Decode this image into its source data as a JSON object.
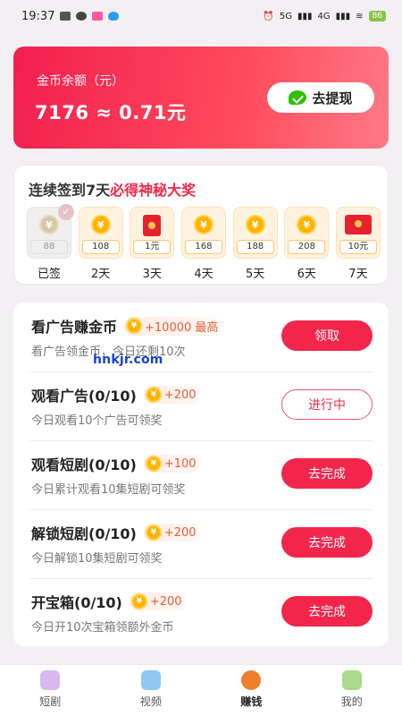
{
  "status_bar": {
    "time": "19:37",
    "network": "5G",
    "network2": "4G",
    "battery": "86"
  },
  "balance": {
    "label": "金币余额（元）",
    "value": "7176 ≈ 0.71元",
    "withdraw_label": "去提现"
  },
  "checkin": {
    "title_prefix": "连续签到7天",
    "title_highlight": "必得神秘大奖",
    "days": [
      {
        "amount": "88",
        "label": "已签",
        "type": "coin",
        "done": true
      },
      {
        "amount": "108",
        "label": "2天",
        "type": "coin",
        "done": false
      },
      {
        "amount": "1元",
        "label": "3天",
        "type": "redpack",
        "done": false
      },
      {
        "amount": "168",
        "label": "4天",
        "type": "coin",
        "done": false
      },
      {
        "amount": "188",
        "label": "5天",
        "type": "coin",
        "done": false
      },
      {
        "amount": "208",
        "label": "6天",
        "type": "coin",
        "done": false
      },
      {
        "amount": "10元",
        "label": "7天",
        "type": "redpack-big",
        "done": false
      }
    ]
  },
  "tasks": [
    {
      "title": "看广告赚金币",
      "reward": "+10000 最高",
      "desc": "看广告领金币，今日还剩10次",
      "button": "领取",
      "style": "filled"
    },
    {
      "title": "观看广告(0/10)",
      "reward": "+200",
      "desc": "今日观看10个广告可领奖",
      "button": "进行中",
      "style": "outline"
    },
    {
      "title": "观看短剧(0/10)",
      "reward": "+100",
      "desc": "今日累计观看10集短剧可领奖",
      "button": "去完成",
      "style": "filled"
    },
    {
      "title": "解锁短剧(0/10)",
      "reward": "+200",
      "desc": "今日解锁10集短剧可领奖",
      "button": "去完成",
      "style": "filled"
    },
    {
      "title": "开宝箱(0/10)",
      "reward": "+200",
      "desc": "今日开10次宝箱领额外金币",
      "button": "去完成",
      "style": "filled"
    }
  ],
  "coin_symbol": "¥",
  "watermark": "hnkjr.com",
  "tabs": [
    {
      "label": "短剧",
      "icon": "drama-icon",
      "color": "#d9b8f0"
    },
    {
      "label": "视频",
      "icon": "video-icon",
      "color": "#8fc8f2"
    },
    {
      "label": "赚钱",
      "icon": "earn-icon",
      "color": "#f07f2b",
      "active": true
    },
    {
      "label": "我的",
      "icon": "profile-icon",
      "color": "#a9d98a"
    }
  ],
  "colors": {
    "accent": "#f2264b",
    "coin": "#ffb300"
  }
}
